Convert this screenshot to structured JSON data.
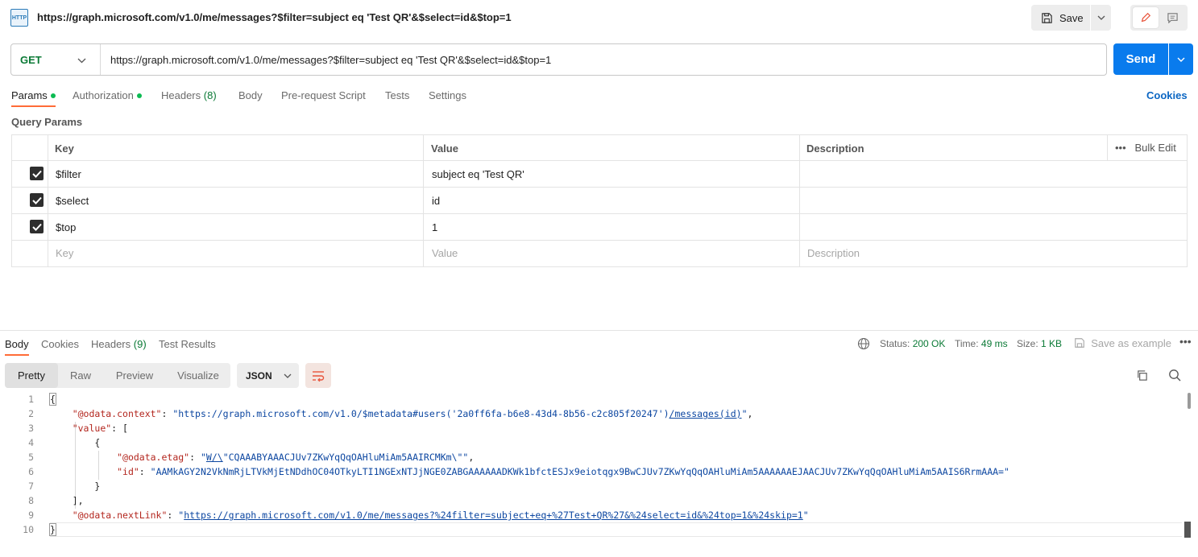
{
  "title_bar": {
    "icon_label": "HTTP",
    "request_title": "https://graph.microsoft.com/v1.0/me/messages?$filter=subject eq 'Test QR'&$select=id&$top=1",
    "save_label": "Save"
  },
  "url_bar": {
    "method": "GET",
    "url": "https://graph.microsoft.com/v1.0/me/messages?$filter=subject eq 'Test QR'&$select=id&$top=1",
    "send_label": "Send"
  },
  "request_tabs": {
    "params": "Params",
    "authorization": "Authorization",
    "headers": "Headers",
    "headers_count": "(8)",
    "body": "Body",
    "pre_request": "Pre-request Script",
    "tests": "Tests",
    "settings": "Settings",
    "cookies": "Cookies"
  },
  "query_params": {
    "title": "Query Params",
    "headers": {
      "key": "Key",
      "value": "Value",
      "description": "Description"
    },
    "bulk_edit": "Bulk Edit",
    "rows": [
      {
        "key": "$filter",
        "value": "subject eq 'Test QR'",
        "checked": true
      },
      {
        "key": "$select",
        "value": "id",
        "checked": true
      },
      {
        "key": "$top",
        "value": "1",
        "checked": true
      }
    ],
    "placeholder": {
      "key": "Key",
      "value": "Value",
      "description": "Description"
    }
  },
  "response": {
    "tabs": {
      "body": "Body",
      "cookies": "Cookies",
      "headers": "Headers",
      "headers_count": "(9)",
      "test_results": "Test Results"
    },
    "status_label": "Status:",
    "status_value": "200 OK",
    "time_label": "Time:",
    "time_value": "49 ms",
    "size_label": "Size:",
    "size_value": "1 KB",
    "save_example": "Save as example",
    "views": [
      "Pretty",
      "Raw",
      "Preview",
      "Visualize"
    ],
    "format": "JSON"
  },
  "code": {
    "line_numbers": [
      "1",
      "2",
      "3",
      "4",
      "5",
      "6",
      "7",
      "8",
      "9",
      "10"
    ],
    "open_brace": "{",
    "close_brace": "}",
    "context_key": "\"@odata.context\"",
    "context_value_pre": "\"https://graph.microsoft.com/v1.0/$metadata#users('2a0ff6fa-b6e8-43d4-8b56-c2c805f20247')",
    "context_value_link": "/messages(id)",
    "context_value_post": "\"",
    "value_key": "\"value\"",
    "etag_key": "\"@odata.etag\"",
    "etag_pre": "\"",
    "etag_link": "W/\\",
    "etag_post": "\"CQAAABYAAACJUv7ZKwYqQqOAHluMiAm5AAIRCMKm\\\"\"",
    "id_key": "\"id\"",
    "id_value": "\"AAMkAGY2N2VkNmRjLTVkMjEtNDdhOC04OTkyLTI1NGExNTJjNGE0ZABGAAAAAADKWk1bfctESJx9eiotqgx9BwCJUv7ZKwYqQqOAHluMiAm5AAAAAAEJAACJUv7ZKwYqQqOAHluMiAm5AAIS6RrmAAA=\"",
    "nextlink_key": "\"@odata.nextLink\"",
    "nextlink_pre": "\"",
    "nextlink_link": "https://graph.microsoft.com/v1.0/me/messages?%24filter=subject+eq+%27Test+QR%27&%24select=id&%24top=1&%24skip=1",
    "nextlink_post": "\""
  },
  "colors": {
    "accent": "#ff6c37",
    "send": "#097bed",
    "method_get": "#0b7a36",
    "status_ok": "#0b7a36",
    "link": "#0b66c3"
  }
}
